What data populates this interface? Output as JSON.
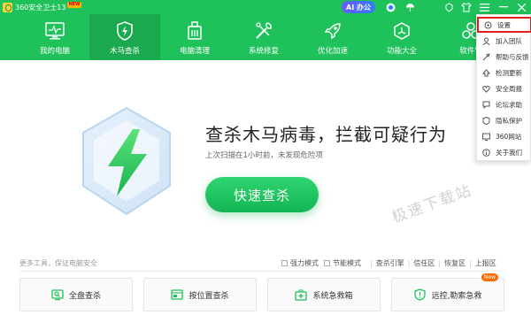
{
  "window": {
    "title": "360安全卫士13",
    "new_badge": "NEW",
    "ai_label": "AI 办公"
  },
  "nav": {
    "items": [
      {
        "label": "我的电脑",
        "icon": "monitor-icon"
      },
      {
        "label": "木马查杀",
        "icon": "shield-bolt-icon",
        "active": true
      },
      {
        "label": "电脑清理",
        "icon": "broom-icon"
      },
      {
        "label": "系统修复",
        "icon": "wrench-icon"
      },
      {
        "label": "优化加速",
        "icon": "rocket-icon"
      },
      {
        "label": "功能大全",
        "icon": "grid-icon"
      },
      {
        "label": "软件管",
        "icon": "software-icon"
      }
    ]
  },
  "main": {
    "headline": "查杀木马病毒，拦截可疑行为",
    "subline": "上次扫描在1小时前，未发现危险项",
    "scan_button": "快速查杀",
    "watermark": "极速下载站"
  },
  "tools": {
    "label": "更多工具，保证电脑安全",
    "options": [
      {
        "label": "强力模式",
        "checked": false
      },
      {
        "label": "节能模式",
        "checked": false
      }
    ],
    "links": [
      "查杀引擎",
      "信任区",
      "恢复区",
      "上报区"
    ],
    "cards": [
      {
        "label": "全盘查杀",
        "icon": "fullscan-icon"
      },
      {
        "label": "按位置查杀",
        "icon": "location-scan-icon"
      },
      {
        "label": "系统急救箱",
        "icon": "firstaid-icon"
      },
      {
        "label": "远控,勒索急救",
        "icon": "ransom-shield-icon",
        "badge": "New"
      }
    ]
  },
  "menu": {
    "items": [
      {
        "label": "设置",
        "icon": "gear-icon",
        "highlighted": true
      },
      {
        "label": "加入团队",
        "icon": "team-icon"
      },
      {
        "label": "帮助与反馈",
        "icon": "help-icon"
      },
      {
        "label": "检测更新",
        "icon": "update-icon"
      },
      {
        "label": "安全周报",
        "icon": "heart-icon"
      },
      {
        "label": "论坛求助",
        "icon": "forum-icon"
      },
      {
        "label": "隐私保护",
        "icon": "privacy-icon"
      },
      {
        "label": "360网站",
        "icon": "website-icon"
      },
      {
        "label": "关于我们",
        "icon": "info-icon"
      }
    ]
  },
  "colors": {
    "brand_green": "#1ec15a",
    "highlight_red": "#e02020"
  }
}
